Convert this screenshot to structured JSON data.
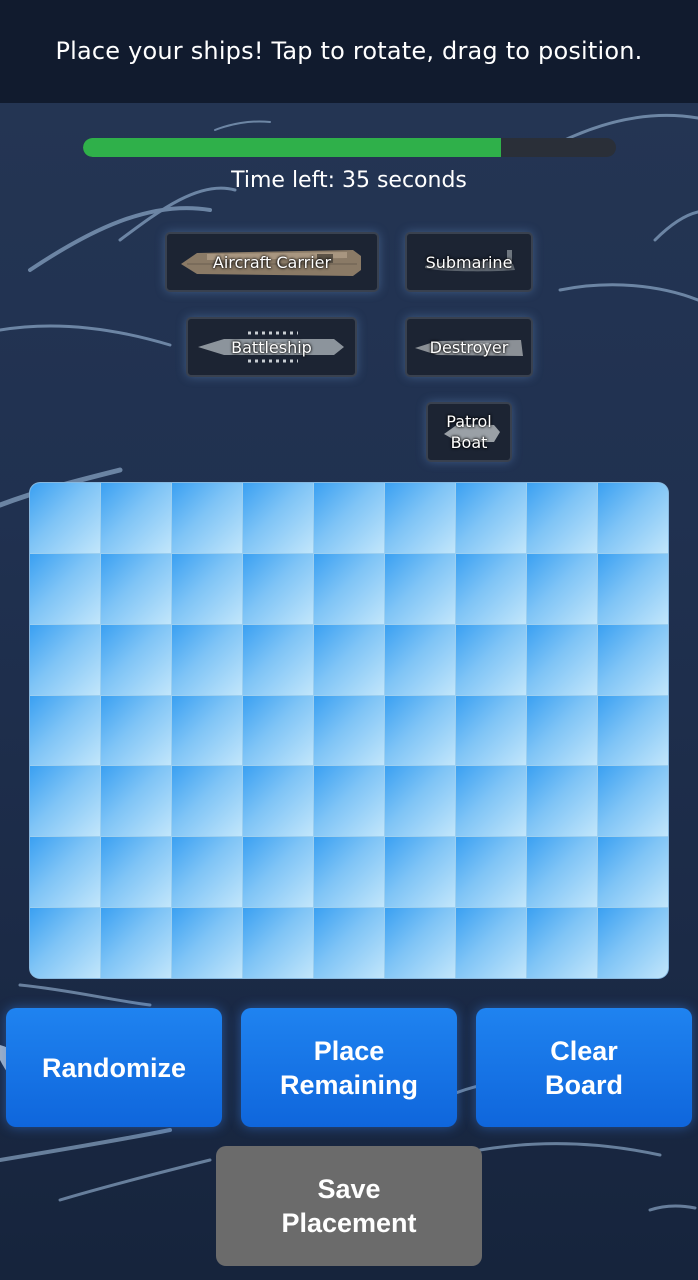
{
  "header": {
    "instruction": "Place your ships! Tap to rotate, drag to position."
  },
  "timer": {
    "label": "Time left: 35 seconds",
    "progress_fraction": 0.785,
    "bar_color": "#2fb04a"
  },
  "ships": [
    {
      "id": "aircraft-carrier",
      "label": "Aircraft Carrier"
    },
    {
      "id": "submarine",
      "label": "Submarine"
    },
    {
      "id": "battleship",
      "label": "Battleship"
    },
    {
      "id": "destroyer",
      "label": "Destroyer"
    },
    {
      "id": "patrol-boat",
      "label": "Patrol\nBoat"
    }
  ],
  "board": {
    "rows": 7,
    "cols": 9
  },
  "buttons": {
    "randomize": "Randomize",
    "place_remaining": "Place\nRemaining",
    "clear_board": "Clear\nBoard",
    "save_placement": "Save\nPlacement"
  },
  "colors": {
    "header_bg": "#111b2e",
    "button_blue": "#1f83f0",
    "button_gray": "#6b6b6b",
    "cell_light": "#c2e6fb",
    "cell_dark": "#3aa0f2"
  }
}
